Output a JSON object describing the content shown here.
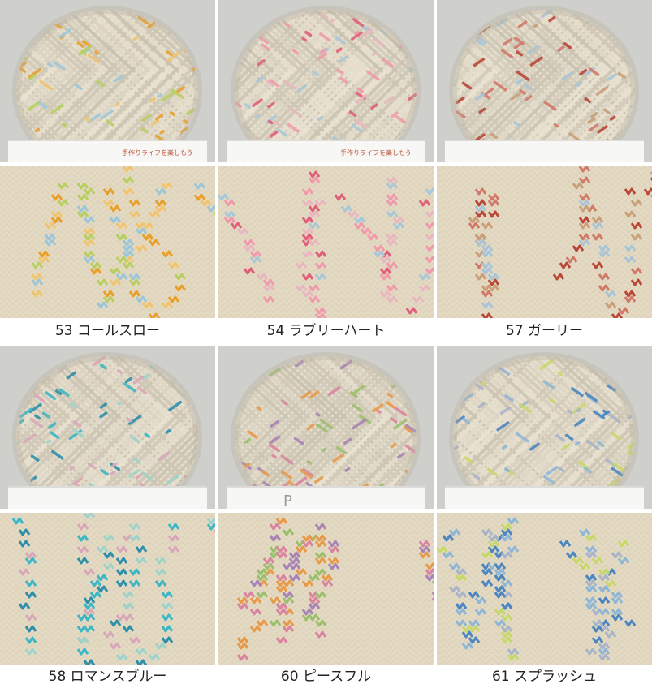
{
  "products": [
    {
      "label": "53 コールスロー",
      "band_text": "手作りライフを楽しもう",
      "colors": [
        "#e8a02c",
        "#9cc6d8",
        "#b7cf62",
        "#f0c36e"
      ]
    },
    {
      "label": "54 ラブリーハート",
      "band_text": "手作りライフを楽しもう",
      "colors": [
        "#e0607a",
        "#f09aaa",
        "#a9c7d6",
        "#e8b7c0"
      ]
    },
    {
      "label": "57 ガーリー",
      "band_text": "",
      "colors": [
        "#b84838",
        "#d07a6a",
        "#a8c4d6",
        "#c9a07a"
      ]
    },
    {
      "label": "58 ロマンスブルー",
      "band_text": "",
      "colors": [
        "#3eb6c4",
        "#2f8fa8",
        "#9fd3c9",
        "#d9a6b8"
      ]
    },
    {
      "label": "60 ピースフル",
      "band_text": "P",
      "colors": [
        "#a884b4",
        "#e79a4a",
        "#9cbf6e",
        "#d985a0"
      ]
    },
    {
      "label": "61 スプラッシュ",
      "band_text": "",
      "colors": [
        "#4d86c0",
        "#c6d86a",
        "#8fb6d4",
        "#a9b4c8"
      ]
    }
  ]
}
